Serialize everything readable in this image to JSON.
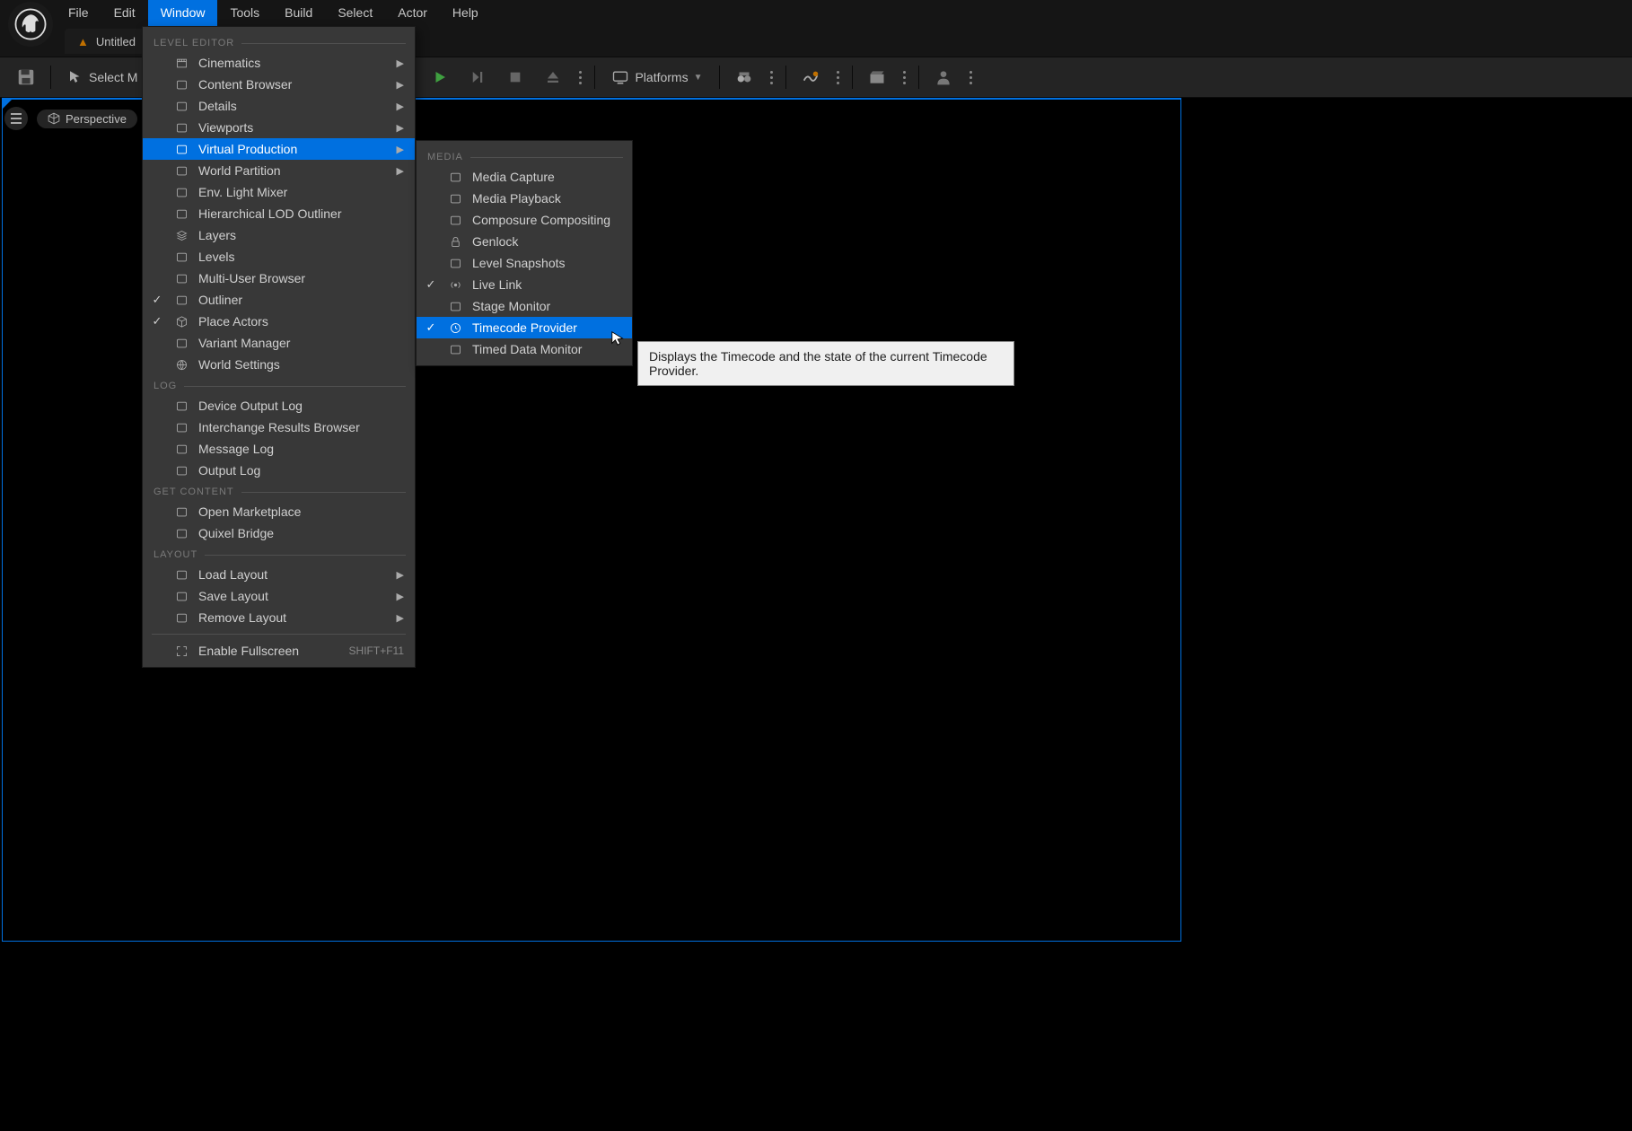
{
  "menubar": [
    "File",
    "Edit",
    "Window",
    "Tools",
    "Build",
    "Select",
    "Actor",
    "Help"
  ],
  "activeMenuIndex": 2,
  "tab": {
    "title": "Untitled"
  },
  "toolbar": {
    "selectMode": "Select M",
    "platforms": "Platforms"
  },
  "viewportHeader": {
    "perspective": "Perspective"
  },
  "windowMenu": {
    "sections": [
      {
        "header": "LEVEL EDITOR",
        "items": [
          {
            "label": "Cinematics",
            "submenu": true,
            "icon": "film"
          },
          {
            "label": "Content Browser",
            "submenu": true,
            "icon": "folder"
          },
          {
            "label": "Details",
            "submenu": true,
            "icon": "pencil"
          },
          {
            "label": "Viewports",
            "submenu": true,
            "icon": "grid"
          },
          {
            "label": "Virtual Production",
            "submenu": true,
            "icon": "vp",
            "highlight": true
          },
          {
            "label": "World Partition",
            "submenu": true,
            "icon": "world"
          },
          {
            "label": "Env. Light Mixer",
            "icon": "target"
          },
          {
            "label": "Hierarchical LOD Outliner",
            "icon": "tree"
          },
          {
            "label": "Layers",
            "icon": "layers"
          },
          {
            "label": "Levels",
            "icon": "levels"
          },
          {
            "label": "Multi-User Browser",
            "icon": "users"
          },
          {
            "label": "Outliner",
            "icon": "list",
            "checked": true
          },
          {
            "label": "Place Actors",
            "icon": "cube",
            "checked": true
          },
          {
            "label": "Variant Manager",
            "icon": "stack"
          },
          {
            "label": "World Settings",
            "icon": "globe"
          }
        ]
      },
      {
        "header": "LOG",
        "items": [
          {
            "label": "Device Output Log",
            "icon": "doc"
          },
          {
            "label": "Interchange Results Browser",
            "icon": "window"
          },
          {
            "label": "Message Log",
            "icon": "msg"
          },
          {
            "label": "Output Log",
            "icon": "doc"
          }
        ]
      },
      {
        "header": "GET CONTENT",
        "items": [
          {
            "label": "Open Marketplace",
            "icon": "bag"
          },
          {
            "label": "Quixel Bridge",
            "icon": "q"
          }
        ]
      },
      {
        "header": "LAYOUT",
        "items": [
          {
            "label": "Load Layout",
            "submenu": true,
            "icon": "load"
          },
          {
            "label": "Save Layout",
            "submenu": true,
            "icon": "save"
          },
          {
            "label": "Remove Layout",
            "submenu": true,
            "icon": "remove"
          }
        ]
      },
      {
        "divider": true
      },
      {
        "items": [
          {
            "label": "Enable Fullscreen",
            "icon": "fullscreen",
            "shortcut": "SHIFT+F11"
          }
        ]
      }
    ]
  },
  "submenu": {
    "header": "MEDIA",
    "items": [
      {
        "label": "Media Capture",
        "icon": "camera"
      },
      {
        "label": "Media Playback",
        "icon": "play"
      },
      {
        "label": "Composure Compositing",
        "icon": "comp"
      },
      {
        "label": "Genlock",
        "icon": "lock"
      },
      {
        "label": "Level Snapshots",
        "icon": "snap"
      },
      {
        "label": "Live Link",
        "icon": "signal",
        "checked": true
      },
      {
        "label": "Stage Monitor",
        "icon": "monitor"
      },
      {
        "label": "Timecode Provider",
        "icon": "clock",
        "checked": true,
        "highlight": true
      },
      {
        "label": "Timed Data Monitor",
        "icon": "timed"
      }
    ]
  },
  "tooltip": "Displays the Timecode and the state of the current Timecode Provider."
}
